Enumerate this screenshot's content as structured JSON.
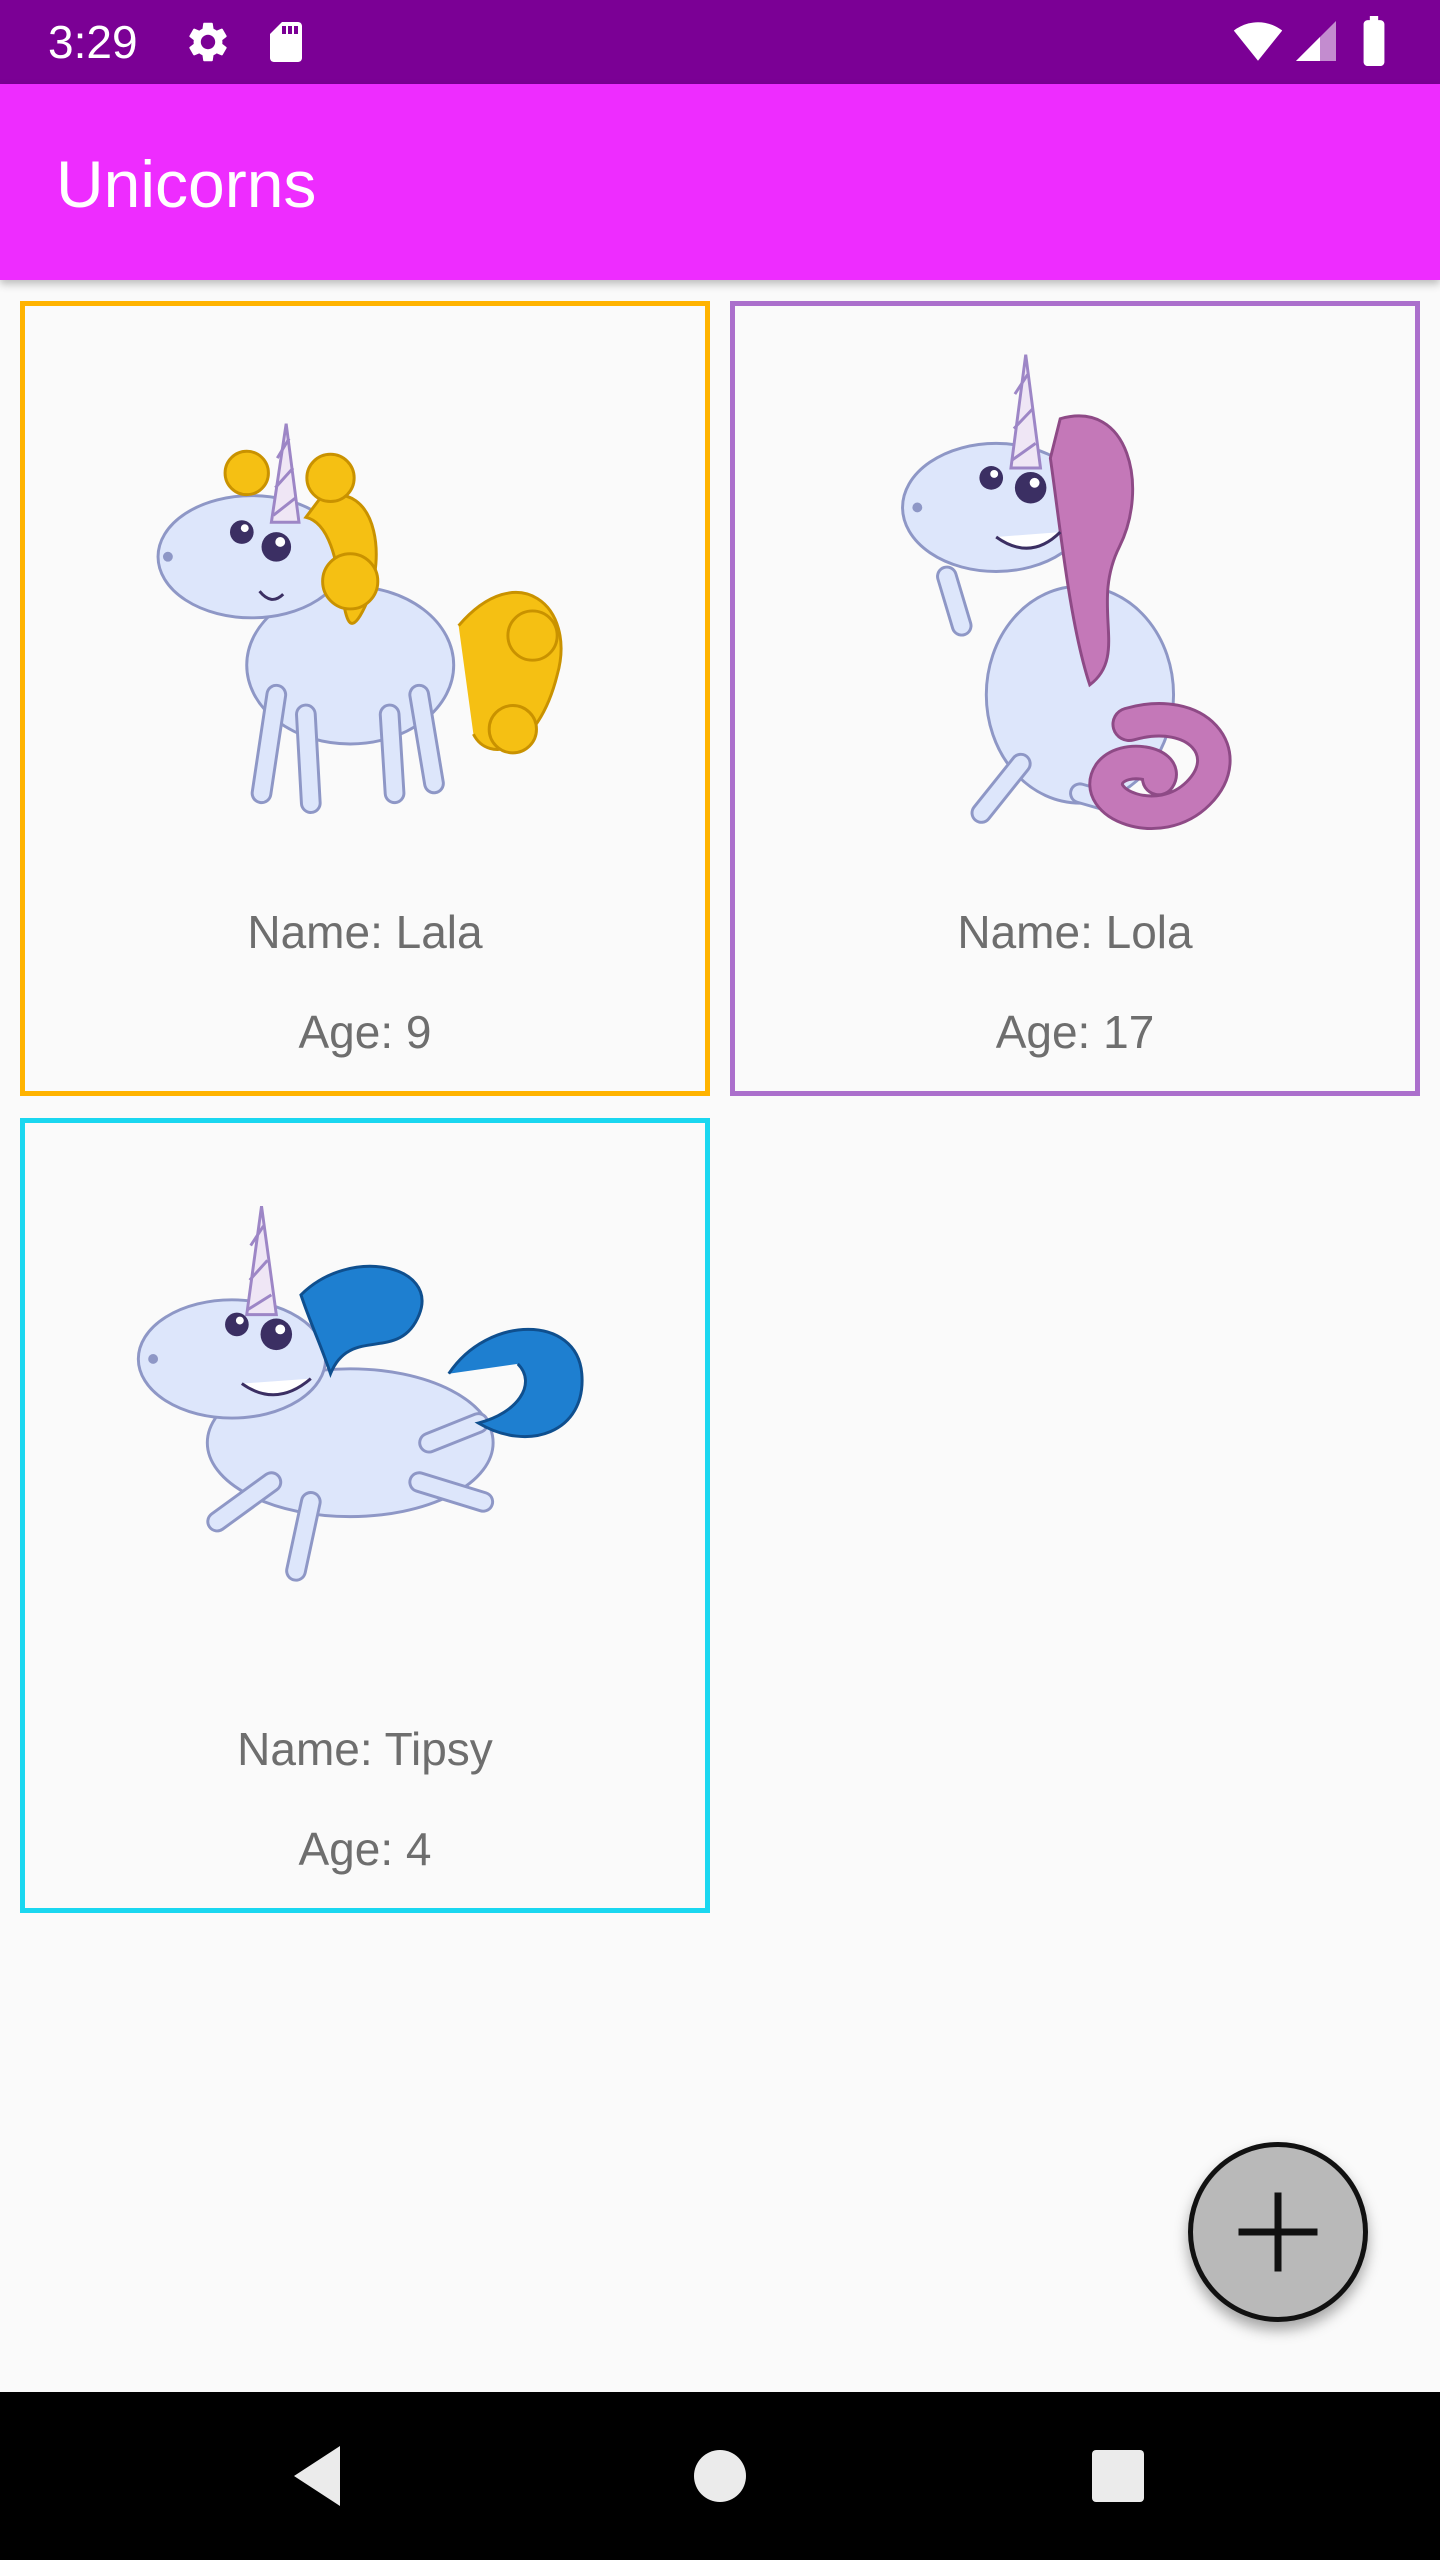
{
  "status_bar": {
    "time": "3:29",
    "icons": [
      "gear-icon",
      "sd-card-icon",
      "wifi-icon",
      "cell-signal-icon",
      "battery-icon"
    ]
  },
  "app_bar": {
    "title": "Unicorns"
  },
  "cards": [
    {
      "name": "Name: Lala",
      "age": "Age: 9",
      "border_color": "#ffb300",
      "mane_color": "#f5c013"
    },
    {
      "name": "Name: Lola",
      "age": "Age: 17",
      "border_color": "#ab6fcc",
      "mane_color": "#c478b8"
    },
    {
      "name": "Name: Tipsy",
      "age": "Age: 4",
      "border_color": "#1ad7f0",
      "mane_color": "#1e7fd0"
    }
  ],
  "fab": {
    "icon": "plus-icon"
  },
  "nav_bar": {
    "icons": [
      "back-icon",
      "home-icon",
      "recents-icon"
    ]
  },
  "colors": {
    "status_bar": "#7b0095",
    "app_bar": "#ee2cff",
    "background": "#fafafa",
    "text_secondary": "#6e6e6e"
  }
}
